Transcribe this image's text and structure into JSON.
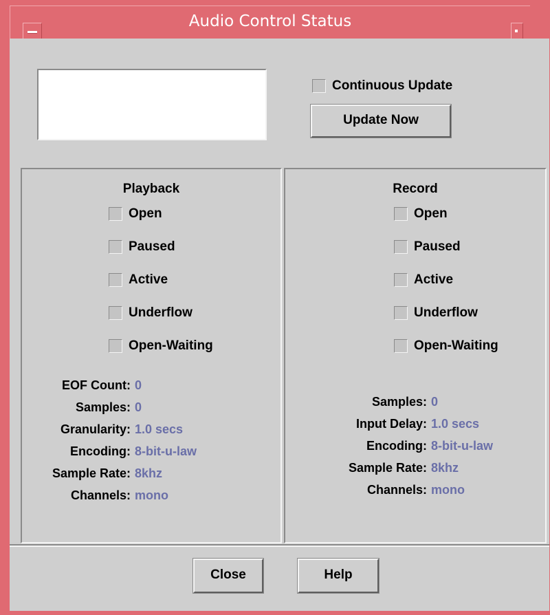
{
  "window": {
    "title": "Audio Control Status"
  },
  "top": {
    "continuous_update_label": "Continuous Update",
    "update_now_label": "Update Now"
  },
  "playback": {
    "title": "Playback",
    "checkboxes": [
      "Open",
      "Paused",
      "Active",
      "Underflow",
      "Open-Waiting"
    ],
    "stats": [
      {
        "label": "EOF Count:",
        "value": "0"
      },
      {
        "label": "Samples:",
        "value": "0"
      },
      {
        "label": "Granularity:",
        "value": "1.0 secs"
      },
      {
        "label": "Encoding:",
        "value": "8-bit-u-law"
      },
      {
        "label": "Sample Rate:",
        "value": "8khz"
      },
      {
        "label": "Channels:",
        "value": "mono"
      }
    ]
  },
  "record": {
    "title": "Record",
    "checkboxes": [
      "Open",
      "Paused",
      "Active",
      "Underflow",
      "Open-Waiting"
    ],
    "stats": [
      {
        "label": "Samples:",
        "value": "0"
      },
      {
        "label": "Input Delay:",
        "value": "1.0 secs"
      },
      {
        "label": "Encoding:",
        "value": "8-bit-u-law"
      },
      {
        "label": "Sample Rate:",
        "value": "8khz"
      },
      {
        "label": "Channels:",
        "value": "mono"
      }
    ]
  },
  "footer": {
    "close_label": "Close",
    "help_label": "Help"
  },
  "colors": {
    "title_bar": "#e06a72",
    "value_text": "#6a6fa8",
    "background": "#cfcfcf"
  }
}
